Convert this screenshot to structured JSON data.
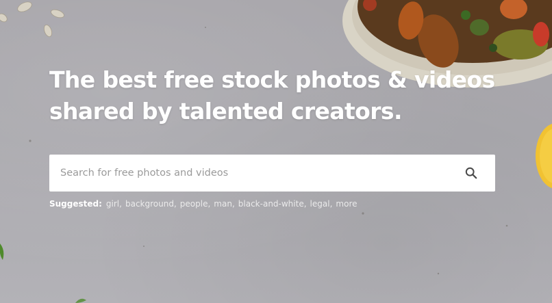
{
  "hero": {
    "headline_line1": "The best free stock photos & videos",
    "headline_line2": "shared by talented creators.",
    "background_color": "#a9a8ad"
  },
  "search": {
    "placeholder": "Search for free photos and videos",
    "value": "",
    "button_icon": "search-icon"
  },
  "suggested": {
    "label": "Suggested:",
    "links": [
      "girl",
      "background",
      "people",
      "man",
      "black-and-white",
      "legal",
      "more"
    ]
  }
}
